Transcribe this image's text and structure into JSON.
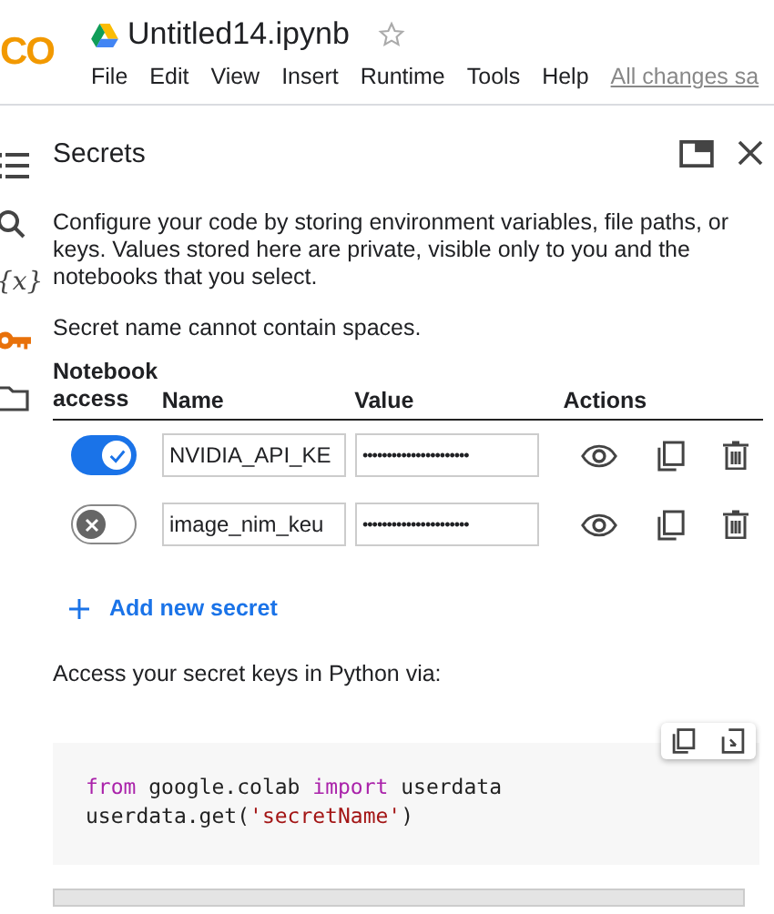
{
  "logo": "CO",
  "file": {
    "title": "Untitled14.ipynb",
    "starred": false
  },
  "menu": [
    "File",
    "Edit",
    "View",
    "Insert",
    "Runtime",
    "Tools",
    "Help"
  ],
  "save_status": "All changes sa",
  "rail": [
    {
      "kind": "toc",
      "selected": false
    },
    {
      "kind": "search",
      "selected": false
    },
    {
      "kind": "variables",
      "glyph": "{x}",
      "selected": false
    },
    {
      "kind": "key",
      "selected": true
    },
    {
      "kind": "folder",
      "selected": false
    }
  ],
  "panel": {
    "title": "Secrets",
    "description": "Configure your code by storing environment variables, file paths, or keys. Values stored here are private, visible only to you and the notebooks that you select.",
    "note": "Secret name cannot contain spaces.",
    "columns": [
      "Notebook access",
      "Name",
      "Value",
      "Actions"
    ],
    "secrets": [
      {
        "on": true,
        "name": "NVIDIA_API_KE",
        "value": "••••••••••••••••••••••"
      },
      {
        "on": false,
        "name": "image_nim_keu",
        "value": "••••••••••••••••••••••"
      }
    ],
    "add_label": "Add new secret",
    "access_text": "Access your secret keys in Python via:",
    "code": [
      [
        {
          "kind": "keyword",
          "text": "from"
        },
        {
          "kind": "plain",
          "text": " google.colab "
        },
        {
          "kind": "keyword",
          "text": "import"
        },
        {
          "kind": "plain",
          "text": " userdata"
        }
      ],
      [
        {
          "kind": "plain",
          "text": "userdata.get("
        },
        {
          "kind": "string",
          "text": "'secretName'"
        },
        {
          "kind": "plain",
          "text": ")"
        }
      ]
    ]
  }
}
